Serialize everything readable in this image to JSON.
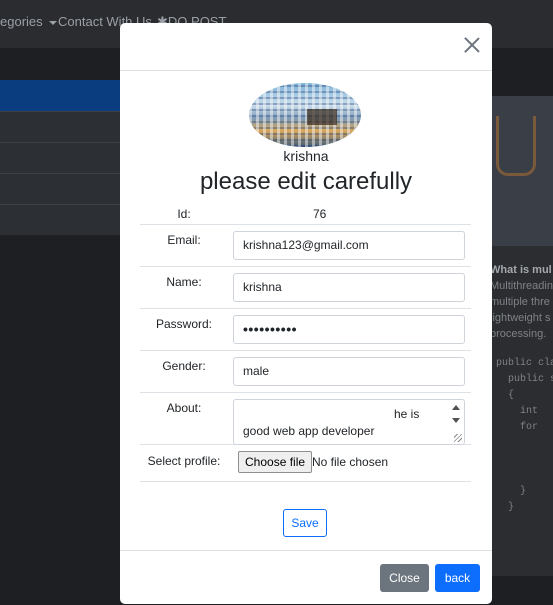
{
  "background": {
    "nav": {
      "categories_label": "egories",
      "contact_label": "Contact With Us",
      "do_post_label": "DO POST"
    },
    "card": {
      "heading": "What is mul",
      "lines": [
        "Multithreadin",
        "multiple thre",
        "lightweight s",
        "processing."
      ],
      "code": [
        "public cla",
        "  public s",
        "  {",
        "    int",
        "    for",
        "",
        "",
        "",
        "    }",
        "  }"
      ]
    }
  },
  "modal": {
    "username": "krishna",
    "title": "please edit carefully",
    "form": {
      "id_label": "Id:",
      "id_value": "76",
      "email_label": "Email:",
      "email_value": "krishna123@gmail.com",
      "name_label": "Name:",
      "name_value": "krishna",
      "password_label": "Password:",
      "password_value": "••••••••••",
      "gender_label": "Gender:",
      "gender_value": "male",
      "about_label": "About:",
      "about_line1": "he is",
      "about_line2": "good web app developer",
      "profile_label": "Select profile:",
      "file_button": "Choose file",
      "file_status": "No file chosen"
    },
    "save_label": "Save",
    "footer": {
      "close_label": "Close",
      "back_label": "back"
    }
  },
  "colors": {
    "primary": "#0d6efd",
    "secondary": "#6c757d",
    "overlay": "#1d1f22"
  }
}
